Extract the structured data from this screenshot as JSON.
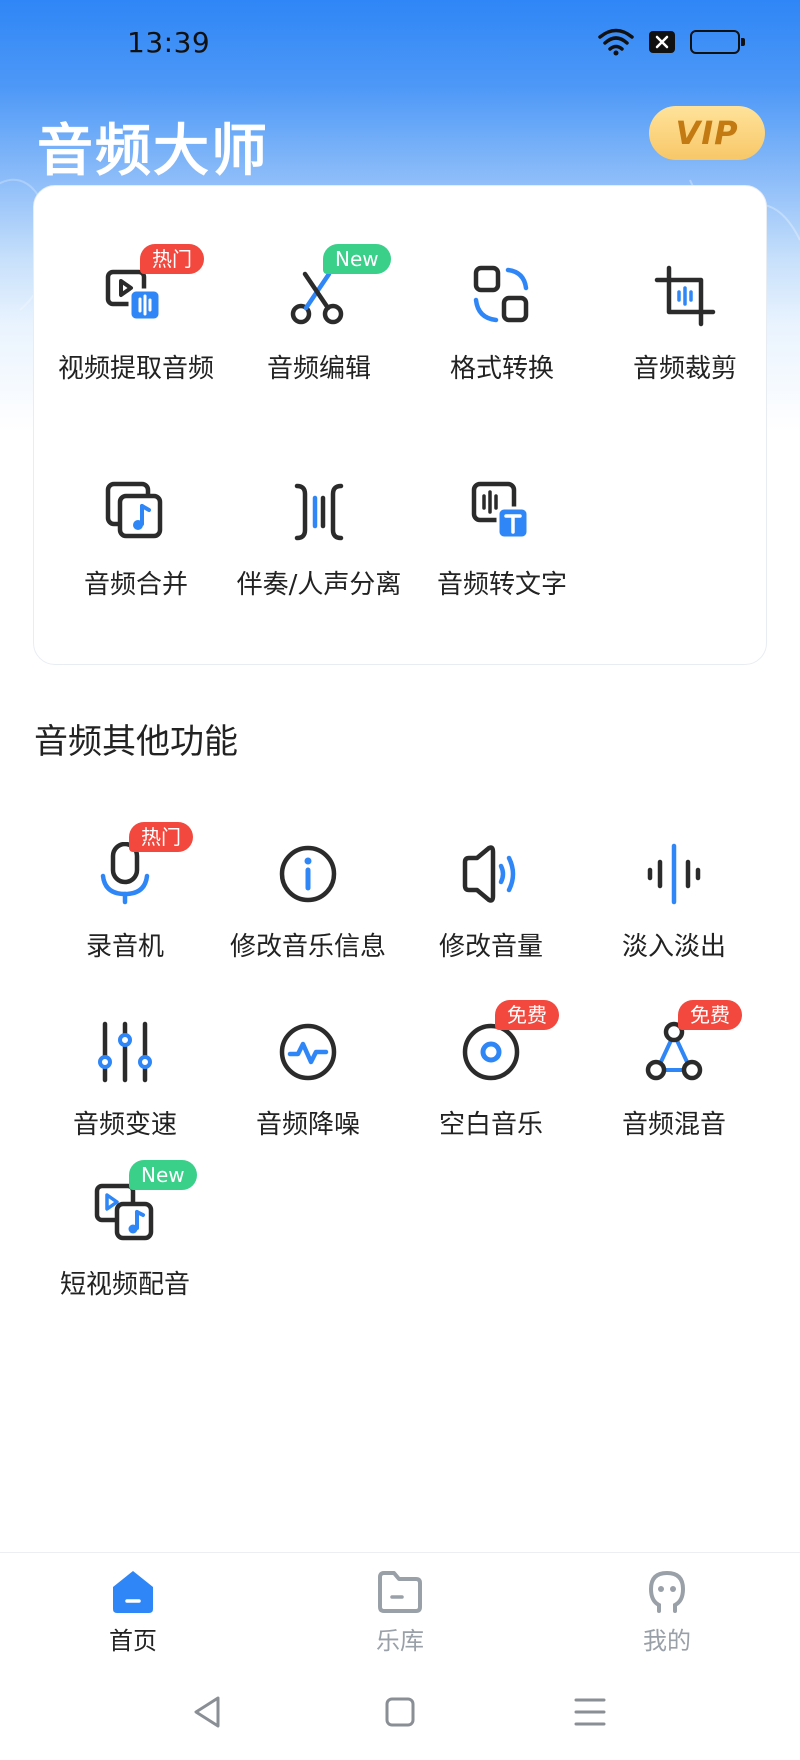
{
  "status_bar": {
    "time": "13:39"
  },
  "header": {
    "title": "音频大师",
    "vip_label": "VIP"
  },
  "main_tools": [
    {
      "label": "视频提取音频",
      "badge": "热门"
    },
    {
      "label": "音频编辑",
      "badge": "New"
    },
    {
      "label": "格式转换"
    },
    {
      "label": "音频裁剪"
    },
    {
      "label": "音频合并"
    },
    {
      "label": "伴奏/人声分离"
    },
    {
      "label": "音频转文字"
    }
  ],
  "other_section": {
    "title": "音频其他功能",
    "tools": [
      {
        "label": "录音机",
        "badge": "热门"
      },
      {
        "label": "修改音乐信息"
      },
      {
        "label": "修改音量"
      },
      {
        "label": "淡入淡出"
      },
      {
        "label": "音频变速"
      },
      {
        "label": "音频降噪"
      },
      {
        "label": "空白音乐",
        "badge": "免费"
      },
      {
        "label": "音频混音",
        "badge": "免费"
      },
      {
        "label": "短视频配音",
        "badge": "New"
      }
    ]
  },
  "bottom_nav": [
    {
      "label": "首页",
      "active": true
    },
    {
      "label": "乐库"
    },
    {
      "label": "我的"
    }
  ],
  "colors": {
    "accent": "#2f86f6",
    "dark": "#2b2b2b",
    "hot": "#f2483e",
    "new": "#3ad08a",
    "vip": "#f8c768"
  }
}
